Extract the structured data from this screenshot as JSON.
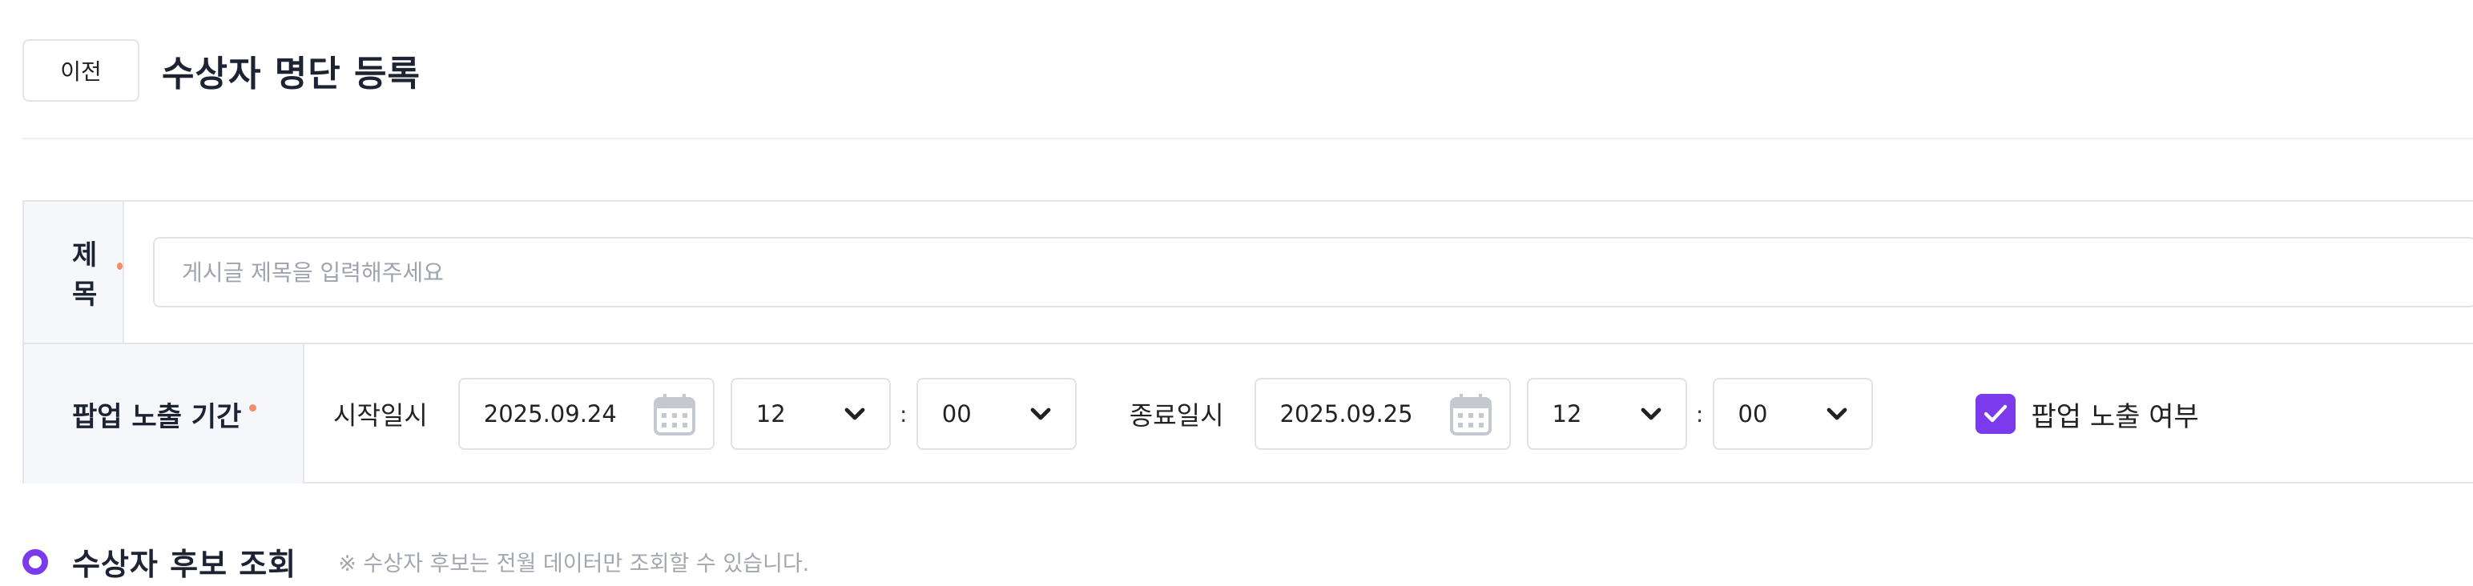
{
  "header": {
    "back_label": "이전",
    "title": "수상자 명단 등록"
  },
  "form": {
    "title_row": {
      "label": "제목",
      "placeholder": "게시글 제목을 입력해주세요",
      "value": ""
    },
    "period_row": {
      "label": "팝업 노출 기간",
      "start_label": "시작일시",
      "start_date": "2025.09.24",
      "start_hour": "12",
      "start_minute": "00",
      "end_label": "종료일시",
      "end_date": "2025.09.25",
      "end_hour": "12",
      "end_minute": "00",
      "time_separator": ":",
      "popup_checkbox_label": "팝업 노출 여부",
      "popup_checked": true
    }
  },
  "section": {
    "title": "수상자 후보 조회",
    "note": "※ 수상자 후보는 전월 데이터만 조회할 수 있습니다."
  },
  "colors": {
    "accent": "#7c3aed",
    "required_dot": "#f58b6a",
    "label_bg": "#f6f7fb"
  }
}
